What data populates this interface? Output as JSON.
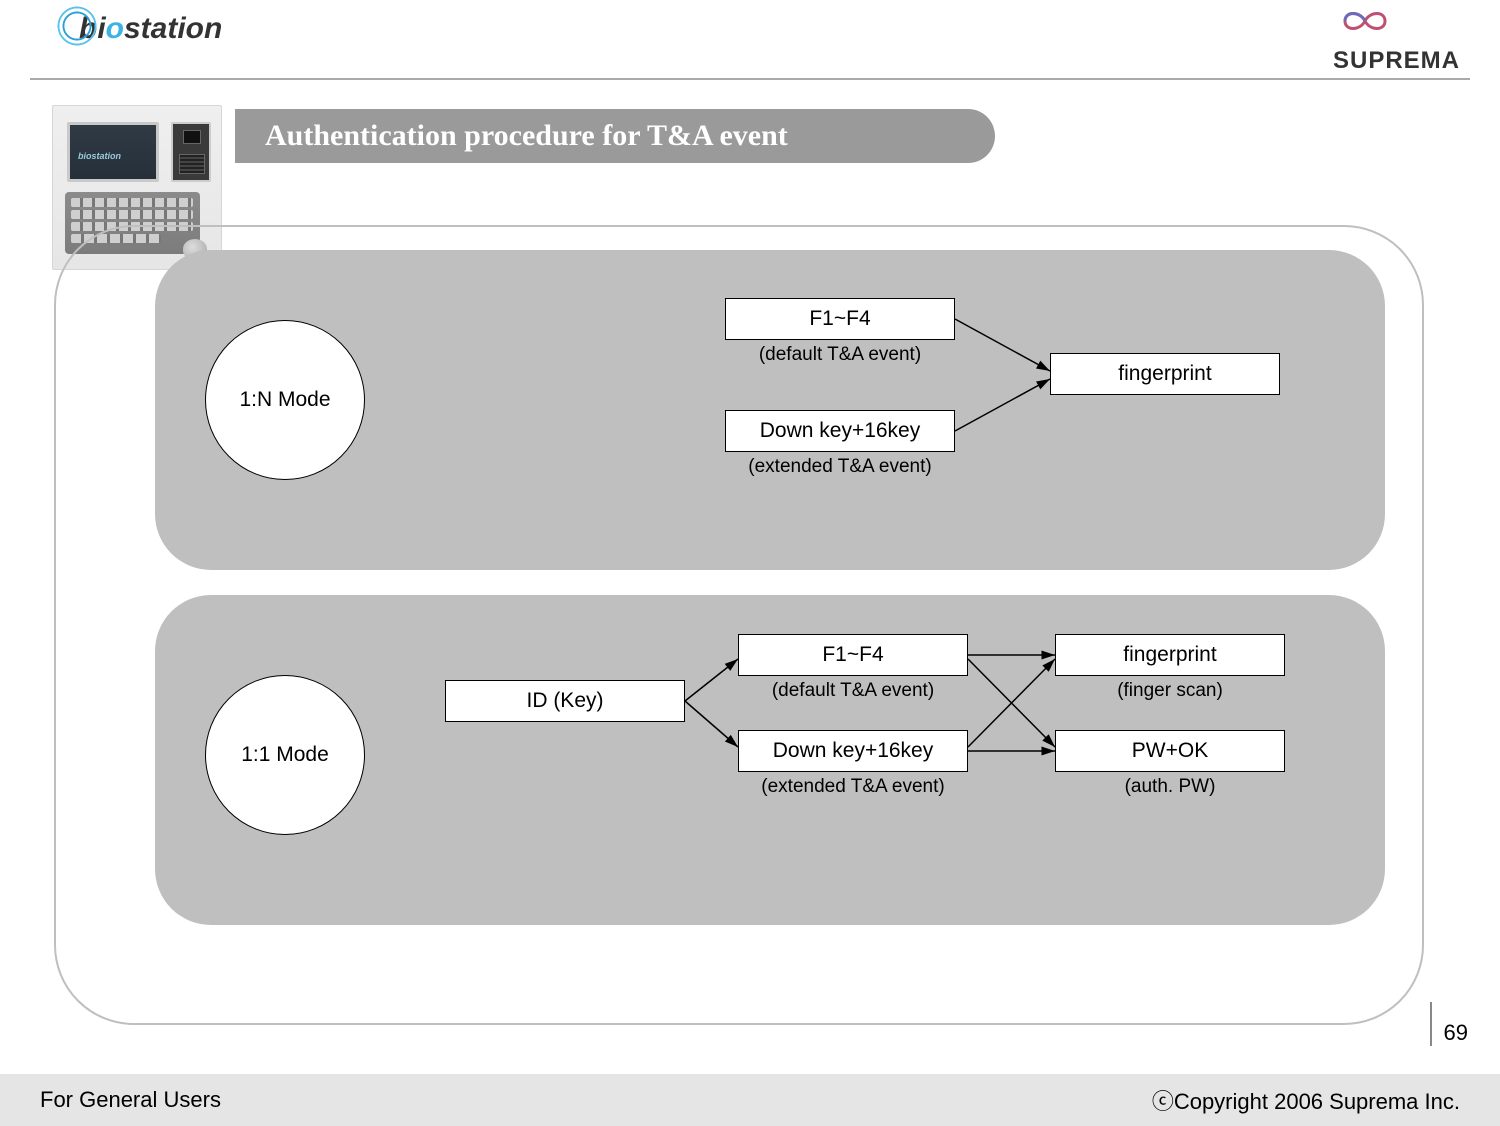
{
  "header": {
    "brand_prefix": "bi",
    "brand_accent": "o",
    "brand_suffix": "station",
    "company": "SUPREMA"
  },
  "title": "Authentication procedure for T&A event",
  "diagram": {
    "mode_1n": {
      "label": "1:N Mode"
    },
    "mode_11": {
      "label": "1:1 Mode"
    },
    "id_key": {
      "label": "ID (Key)"
    },
    "f1_f4": {
      "label": "F1~F4",
      "caption": "(default T&A event)"
    },
    "down_16": {
      "label": "Down key+16key",
      "caption": "(extended T&A event)"
    },
    "fingerprint_simple": {
      "label": "fingerprint"
    },
    "fingerprint": {
      "label": "fingerprint",
      "caption": "(finger scan)"
    },
    "pw_ok": {
      "label": "PW+OK",
      "caption": "(auth. PW)"
    }
  },
  "footer": {
    "left": "For General Users",
    "right": "ⓒCopyright 2006 Suprema Inc."
  },
  "page_number": "69",
  "device_brand": "biostation"
}
